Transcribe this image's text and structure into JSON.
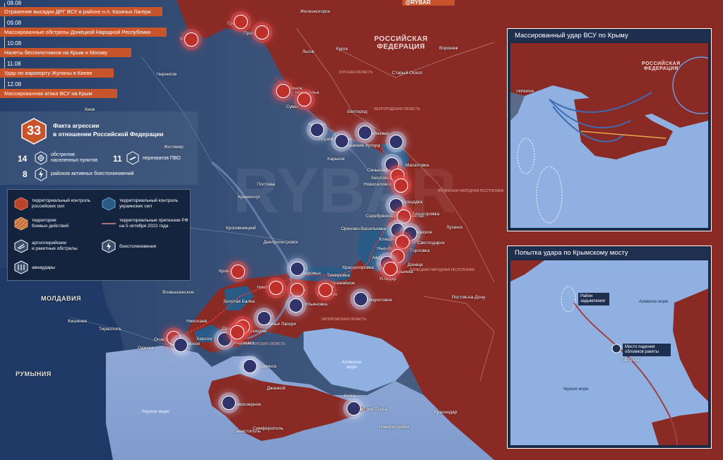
{
  "timeline": [
    {
      "date": "08.08",
      "text": "Отражение высадки ДРГ ВСУ в районе н.п. Казачьи Лагери"
    },
    {
      "date": "09.08",
      "text": "Массированные обстрелы Донецкой Народной Республики"
    },
    {
      "date": "10.08",
      "text": "Налеты беспилотников на Крым и Москву"
    },
    {
      "date": "11.08",
      "text": "Удар по аэропорту Жуляны в Киеве"
    },
    {
      "date": "12.08",
      "text": "Массированная атака ВСУ на Крым"
    }
  ],
  "summary": {
    "total": "33",
    "total_label_line1": "Факта агрессии",
    "total_label_line2": "в отношении Российской Федерации",
    "stats": [
      {
        "value": "14",
        "label_line1": "обстрелов",
        "label_line2": "населенных пунктов",
        "icon": "crosshair-icon"
      },
      {
        "value": "11",
        "label_line1": "перехватов ПВО",
        "label_line2": "",
        "icon": "missile-icon"
      },
      {
        "value": "8",
        "label_line1": "районов активных боестолкновений",
        "label_line2": "",
        "icon": "lightning-icon"
      }
    ]
  },
  "legend": {
    "items": [
      {
        "label_line1": "территориальный контроль",
        "label_line2": "российских сил",
        "icon": "red-hex-icon"
      },
      {
        "label_line1": "территориальный контроль",
        "label_line2": "украинских сил",
        "icon": "blue-hex-icon"
      },
      {
        "label_line1": "территория",
        "label_line2": "боевых действий",
        "icon": "hatched-hex-icon"
      },
      {
        "label_line1": "территориальные претензии РФ",
        "label_line2": "на 5 октября 2022 года",
        "icon": "claim-line-icon"
      },
      {
        "label_line1": "артиллерийские",
        "label_line2": "и ракетные обстрелы",
        "icon": "artillery-icon"
      },
      {
        "label_line1": "боестолкновения",
        "label_line2": "",
        "icon": "clash-icon"
      },
      {
        "label_line1": "авиаудары",
        "label_line2": "",
        "icon": "airstrike-icon"
      }
    ]
  },
  "brand": {
    "name": "@RYBAR"
  },
  "map": {
    "big_labels": [
      "РОССИЙСКАЯ",
      "ФЕДЕРАЦИЯ"
    ],
    "countries": [
      "МОЛДАВИЯ",
      "РУМЫНИЯ"
    ],
    "seas": [
      "Черное море",
      "Азовское море"
    ],
    "cities": [
      "Железногорск",
      "Гремяч",
      "Прогресс",
      "Климово",
      "Курск",
      "Льгов",
      "Воронеж",
      "Чернигов",
      "Старый Оскол",
      "Ястребиное",
      "Мирополье",
      "Сумы",
      "Белгород",
      "Козинка",
      "Шебекино",
      "Грузов Казачок",
      "Волчанские Хутора",
      "Харьков",
      "Масютовка",
      "Синьковка",
      "Кисловка",
      "Новоселовское",
      "Полтава",
      "Кременчуг",
      "Площадка",
      "Горское",
      "Серебрянское лесничество",
      "Белогоровка",
      "Орехово-Васильевка",
      "Покровское",
      "Клещеевка",
      "Светлодарск",
      "Луганск",
      "Днепропетровск",
      "Нью-Йорк",
      "Горловка",
      "Авдеевка",
      "Марьинка",
      "Донецк",
      "Запорожье",
      "Красногоровка",
      "Угледар",
      "Темировка",
      "Орехов",
      "Уражайное",
      "Работино",
      "Плавни",
      "Кривой Рог",
      "Никополь",
      "Золотая Балка",
      "Ульяновка",
      "Очеретовое",
      "Ростов-на-Дону",
      "Николаев",
      "Казачьи Лагери",
      "Херсон",
      "Поматовка",
      "Казацкое",
      "Радиевск",
      "Очаков",
      "Покровское",
      "Кишинев",
      "Тирасполь",
      "Одесса",
      "Армянск",
      "Джанкой",
      "Новоозерное",
      "Керчь",
      "Остров Тузла",
      "Краснодар",
      "Новороссийск",
      "Севастополь",
      "Симферополь",
      "Возвышенское",
      "Житомир",
      "Киев",
      "Кропивницкий"
    ],
    "region_labels": [
      "КУРСКАЯ ОБЛАСТЬ",
      "БЕЛГОРОДСКАЯ ОБЛАСТЬ",
      "ЛУГАНСКАЯ НАРОДНАЯ РЕСПУБЛИКА",
      "ДОНЕЦКАЯ НАРОДНАЯ РЕСПУБЛИКА",
      "ЗАПОРОЖСКАЯ ОБЛАСТЬ",
      "ХЕРСОНСКАЯ ОБЛАСТЬ"
    ],
    "watermark": "RYBAR"
  },
  "inset_crimea": {
    "title": "Массированный удар ВСУ по Крыму",
    "labels": [
      "РОССИЙСКАЯ",
      "ФЕДЕРАЦИЯ",
      "УКРАИНА"
    ]
  },
  "inset_bridge": {
    "title": "Попытка удара по Крымскому мосту",
    "labels": {
      "smoke": "Район задымления",
      "debris": "Место падения обломков ракеты",
      "tuzla": "о-в Тузла",
      "azov": "Азовское море",
      "black": "Черное море"
    }
  },
  "colors": {
    "russia": "#8c2a26",
    "ukraine_control": "#2a5a86",
    "sea": "#8fb0e0",
    "timeline_bar": "#c8542c",
    "panel": "#12213a"
  }
}
